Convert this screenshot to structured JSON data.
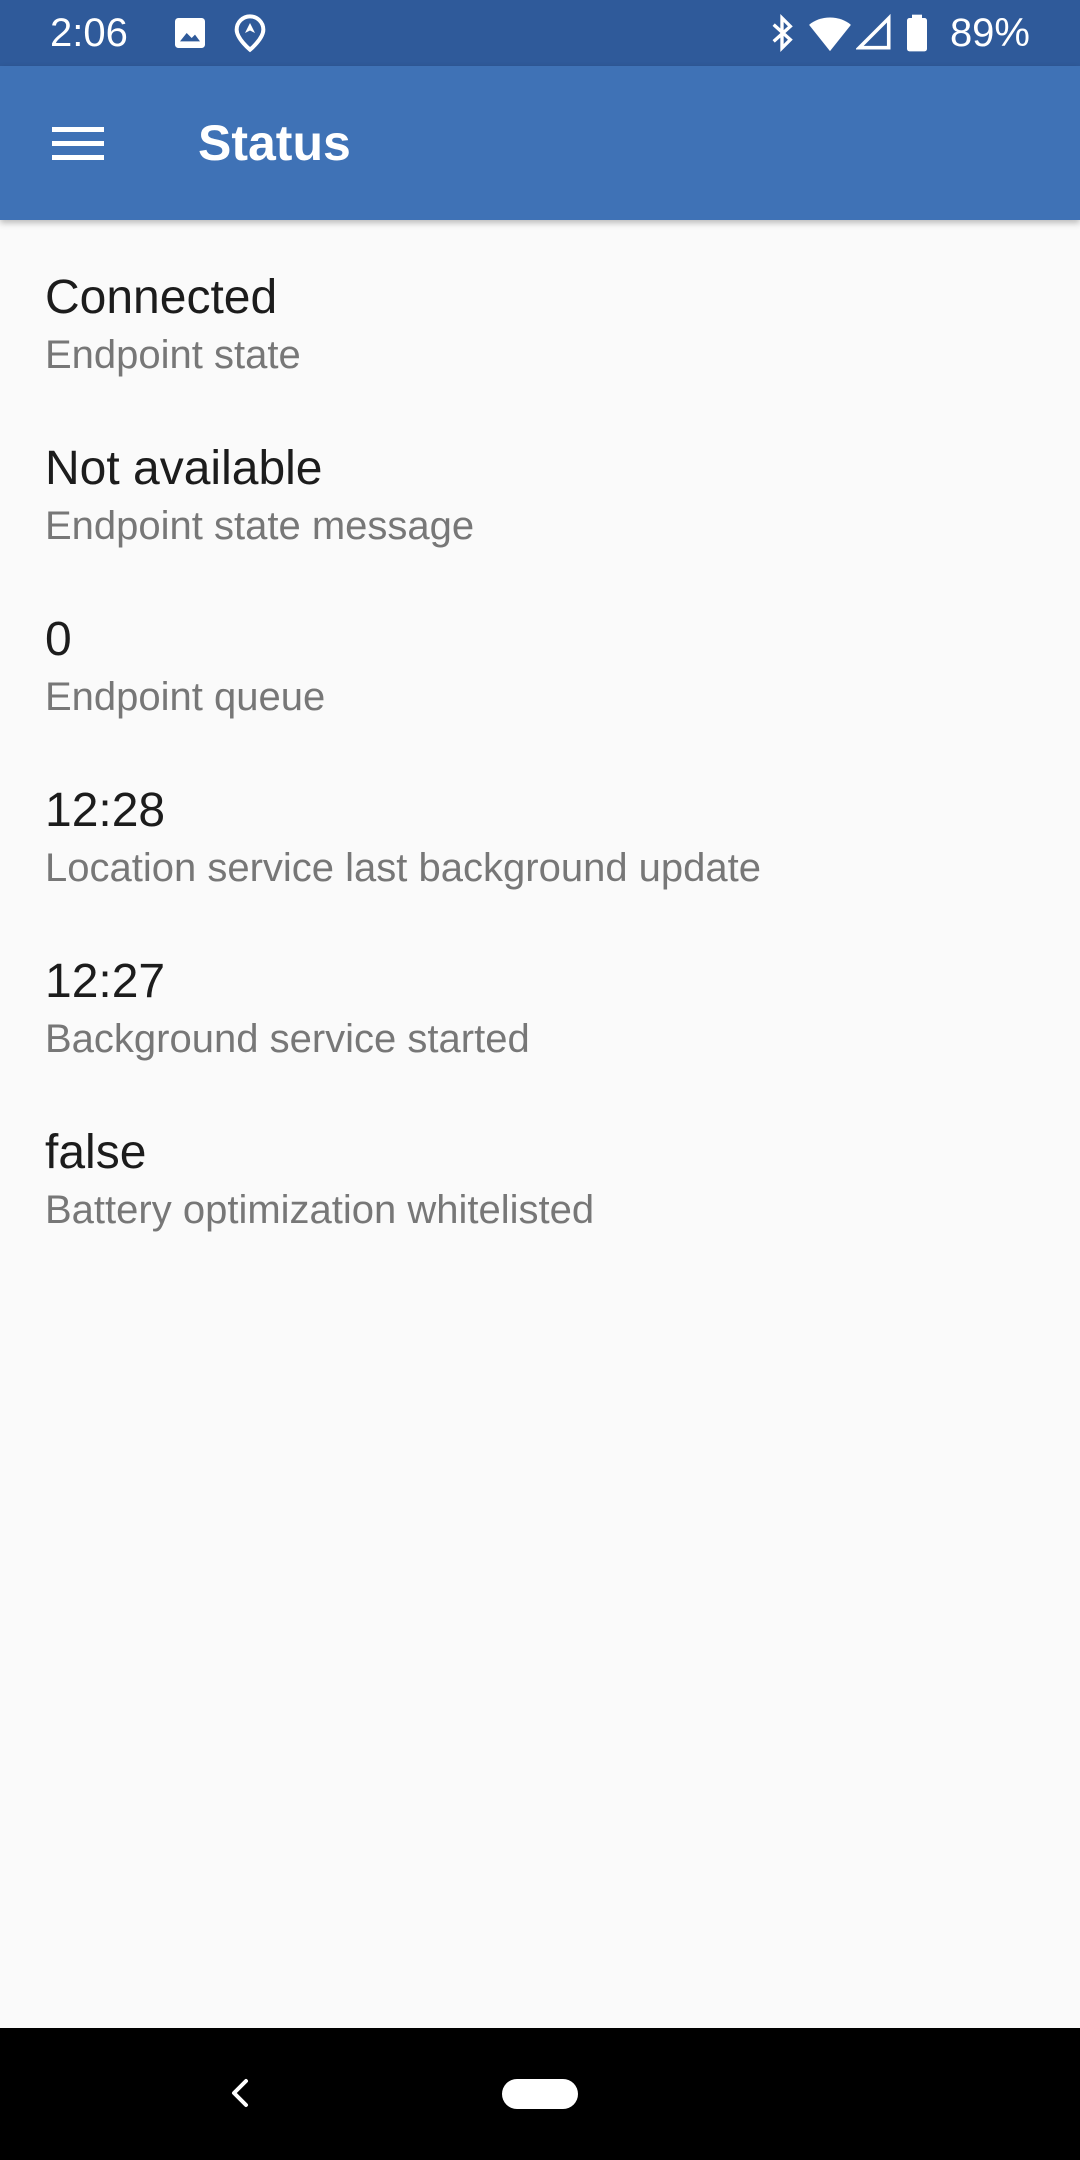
{
  "status_bar": {
    "time": "2:06",
    "battery_percent": "89%",
    "icons": [
      "image-icon",
      "location-icon",
      "bluetooth-icon",
      "wifi-icon",
      "cell-signal-icon",
      "battery-icon"
    ]
  },
  "app_bar": {
    "title": "Status",
    "menu_icon": "hamburger-menu-icon"
  },
  "items": [
    {
      "value": "Connected",
      "label": "Endpoint state"
    },
    {
      "value": "Not available",
      "label": "Endpoint state message"
    },
    {
      "value": "0",
      "label": "Endpoint queue"
    },
    {
      "value": "12:28",
      "label": "Location service last background update"
    },
    {
      "value": "12:27",
      "label": "Background service started"
    },
    {
      "value": "false",
      "label": "Battery optimization whitelisted"
    }
  ],
  "colors": {
    "status_bar": "#2f5a9a",
    "app_bar": "#3f72b6",
    "background": "#fafafa",
    "value_text": "#1c1c1c",
    "label_text": "#777777",
    "nav_bar": "#000000"
  },
  "nav_bar": {
    "back_icon": "back-chevron-icon",
    "home_icon": "home-pill-icon"
  }
}
